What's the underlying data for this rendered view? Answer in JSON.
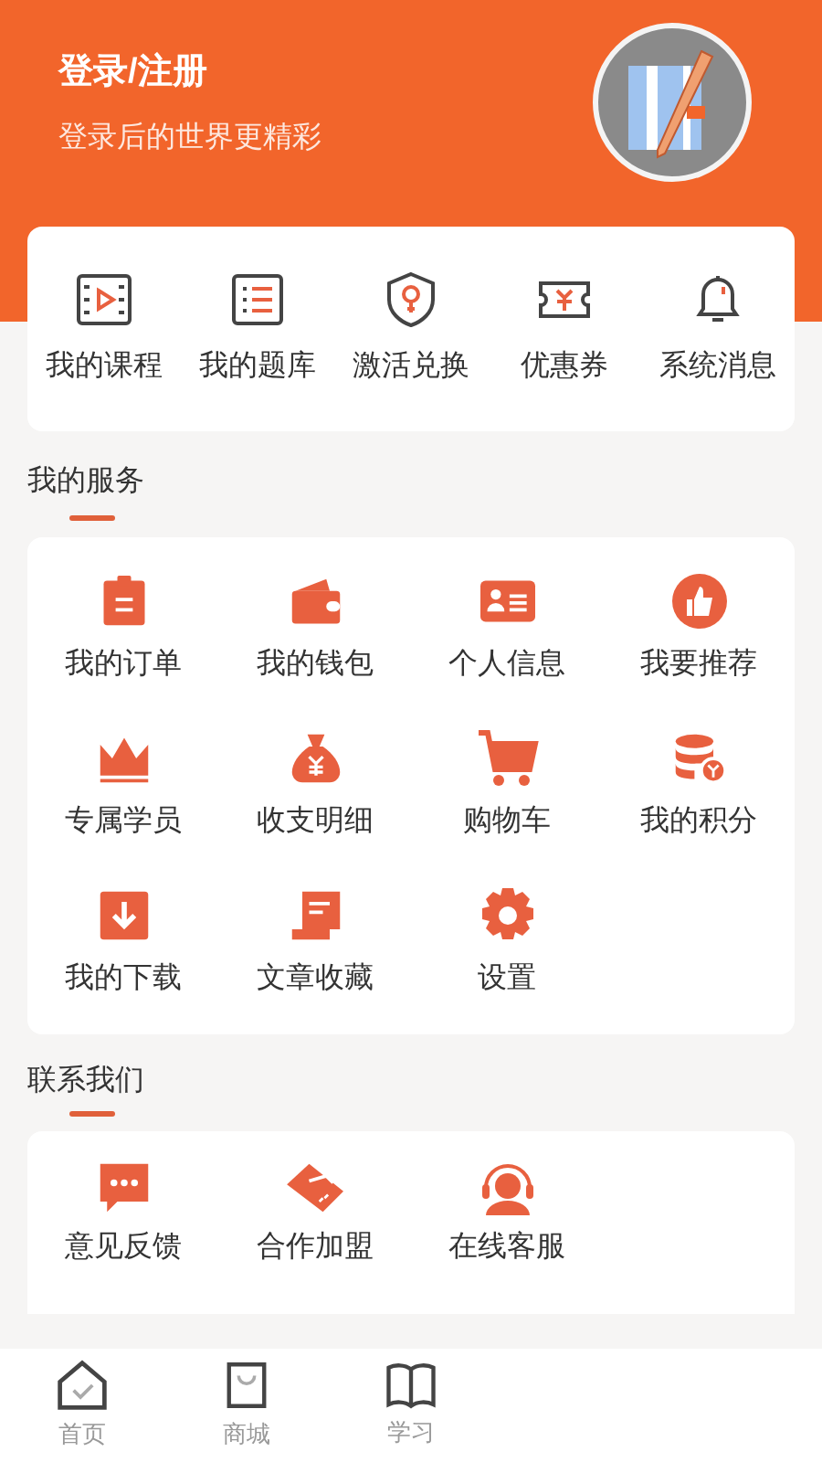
{
  "header": {
    "title": "登录/注册",
    "subtitle": "登录后的世界更精彩"
  },
  "quick_links": [
    {
      "label": "我的课程"
    },
    {
      "label": "我的题库"
    },
    {
      "label": "激活兑换"
    },
    {
      "label": "优惠券"
    },
    {
      "label": "系统消息"
    }
  ],
  "services": {
    "title": "我的服务",
    "items": [
      {
        "label": "我的订单"
      },
      {
        "label": "我的钱包"
      },
      {
        "label": "个人信息"
      },
      {
        "label": "我要推荐"
      },
      {
        "label": "专属学员"
      },
      {
        "label": "收支明细"
      },
      {
        "label": "购物车"
      },
      {
        "label": "我的积分"
      },
      {
        "label": "我的下载"
      },
      {
        "label": "文章收藏"
      },
      {
        "label": "设置"
      }
    ]
  },
  "contact": {
    "title": "联系我们",
    "items": [
      {
        "label": "意见反馈"
      },
      {
        "label": "合作加盟"
      },
      {
        "label": "在线客服"
      }
    ]
  },
  "tab_bar": [
    {
      "label": "首页",
      "selected": false
    },
    {
      "label": "商城",
      "selected": false
    },
    {
      "label": "学习",
      "selected": false
    }
  ]
}
